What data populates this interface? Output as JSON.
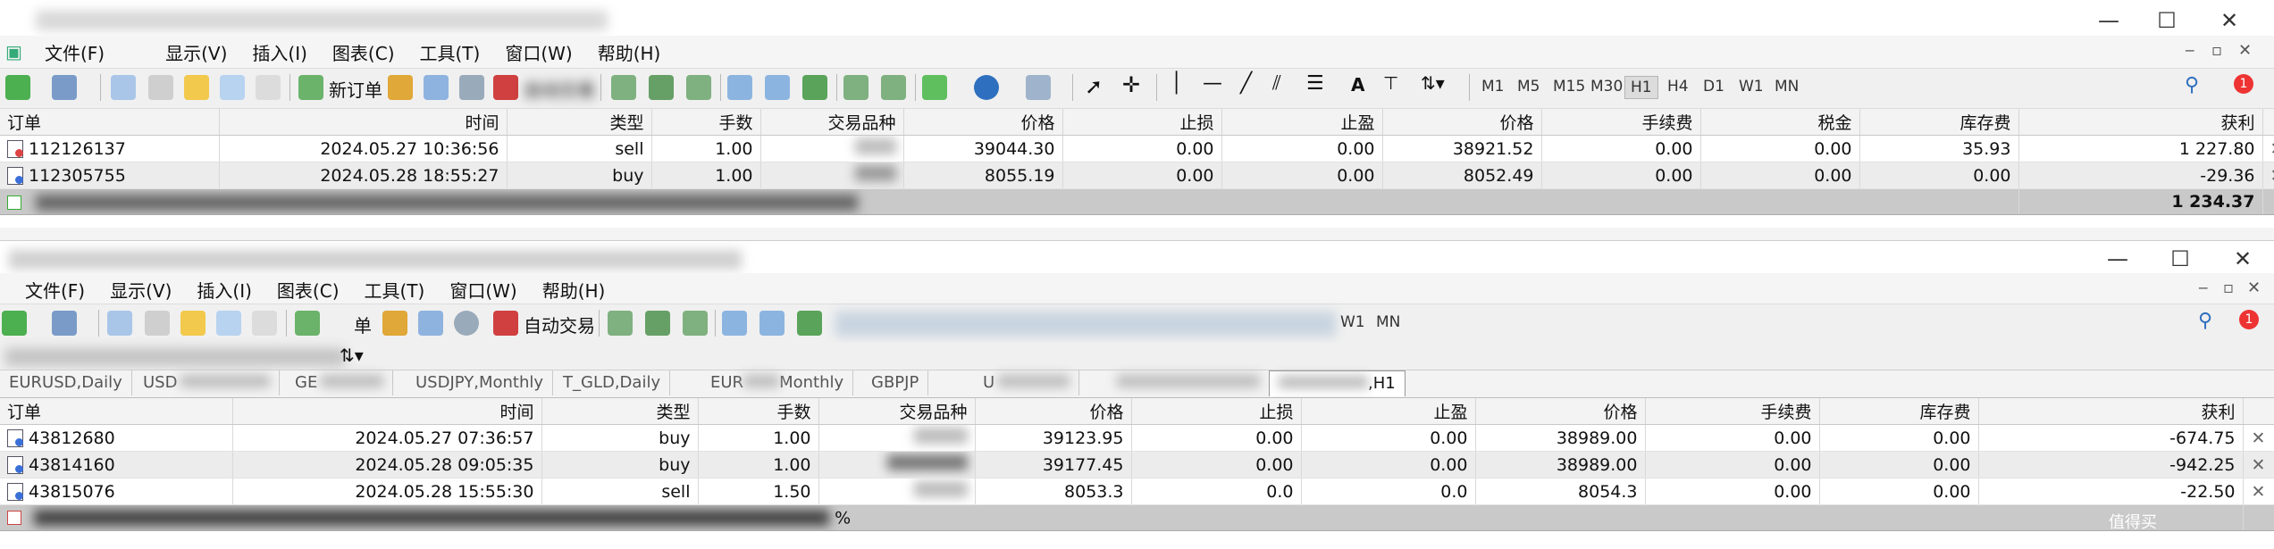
{
  "top_window": {
    "menu": [
      "文件(F)",
      "显示(V)",
      "插入(I)",
      "图表(C)",
      "工具(T)",
      "窗口(W)",
      "帮助(H)"
    ],
    "new_order_label": "新订单",
    "auto_trading_label": "自动交易",
    "timeframes": [
      "M1",
      "M5",
      "M15",
      "M30",
      "H1",
      "H4",
      "D1",
      "W1",
      "MN"
    ],
    "active_timeframe": "H1",
    "notification_count": "1",
    "columns": [
      "订单",
      "时间",
      "类型",
      "手数",
      "交易品种",
      "价格",
      "止损",
      "止盈",
      "价格",
      "手续费",
      "税金",
      "库存费",
      "获利"
    ],
    "rows": [
      {
        "order": "112126137",
        "time": "2024.05.27 10:36:56",
        "type": "sell",
        "lots": "1.00",
        "symbol": "",
        "price": "39044.30",
        "sl": "0.00",
        "tp": "0.00",
        "cur_price": "38921.52",
        "commission": "0.00",
        "tax": "0.00",
        "swap": "35.93",
        "profit": "1 227.80"
      },
      {
        "order": "112305755",
        "time": "2024.05.28 18:55:27",
        "type": "buy",
        "lots": "1.00",
        "symbol": "",
        "price": "8055.19",
        "sl": "0.00",
        "tp": "0.00",
        "cur_price": "8052.49",
        "commission": "0.00",
        "tax": "0.00",
        "swap": "0.00",
        "profit": "-29.36"
      }
    ],
    "total_profit": "1 234.37"
  },
  "bottom_window": {
    "menu": [
      "文件(F)",
      "显示(V)",
      "插入(I)",
      "图表(C)",
      "工具(T)",
      "窗口(W)",
      "帮助(H)"
    ],
    "new_order_label": "单",
    "auto_trading_label": "自动交易",
    "timeframes": [
      "W1",
      "MN"
    ],
    "notification_count": "1",
    "chart_tabs": [
      "EURUSD,Daily",
      "USD",
      "GE",
      "USDJPY,Monthly",
      "T_GLD,Daily",
      "EUR",
      "Monthly",
      "GBPJP",
      "U",
      ",H1"
    ],
    "columns": [
      "订单",
      "时间",
      "类型",
      "手数",
      "交易品种",
      "价格",
      "止损",
      "止盈",
      "价格",
      "手续费",
      "库存费",
      "获利"
    ],
    "rows": [
      {
        "order": "43812680",
        "time": "2024.05.27 07:36:57",
        "type": "buy",
        "lots": "1.00",
        "symbol": "",
        "price": "39123.95",
        "sl": "0.00",
        "tp": "0.00",
        "cur_price": "38989.00",
        "commission": "0.00",
        "swap": "0.00",
        "profit": "-674.75"
      },
      {
        "order": "43814160",
        "time": "2024.05.28 09:05:35",
        "type": "buy",
        "lots": "1.00",
        "symbol": "",
        "price": "39177.45",
        "sl": "0.00",
        "tp": "0.00",
        "cur_price": "38989.00",
        "commission": "0.00",
        "swap": "0.00",
        "profit": "-942.25"
      },
      {
        "order": "43815076",
        "time": "2024.05.28 15:55:30",
        "type": "sell",
        "lots": "1.50",
        "symbol": "",
        "price": "8053.3",
        "sl": "0.0",
        "tp": "0.0",
        "cur_price": "8054.3",
        "commission": "0.00",
        "swap": "0.00",
        "profit": "-22.50"
      }
    ],
    "summary_fragment": "%",
    "watermark": "值得买"
  }
}
